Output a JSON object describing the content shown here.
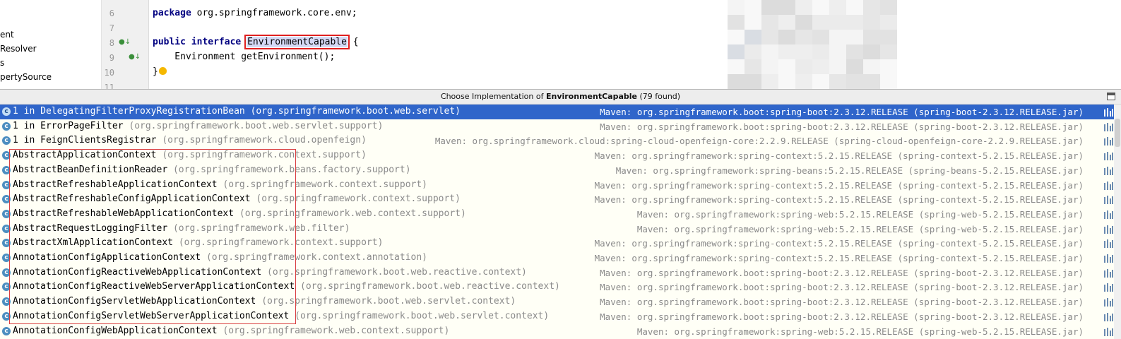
{
  "tree": {
    "items": [
      "ent",
      "Resolver",
      "s",
      "pertySource"
    ]
  },
  "editor": {
    "line_numbers": [
      "6",
      "7",
      "8",
      "9",
      "10",
      "11"
    ],
    "package_keyword": "package",
    "package_name": " org.springframework.core.env;",
    "public_keyword": "public",
    "interface_keyword": "interface",
    "interface_name": "EnvironmentCapable",
    "open_brace": " {",
    "method_line": "    Environment getEnvironment();",
    "close_brace": "}"
  },
  "popup": {
    "title_prefix": "Choose Implementation of ",
    "title_class": "EnvironmentCapable",
    "title_suffix": " (79 found)",
    "rows": [
      {
        "name": "1 in DelegatingFilterProxyRegistrationBean",
        "pkg": "(org.springframework.boot.web.servlet)",
        "maven": "Maven: org.springframework.boot:spring-boot:2.3.12.RELEASE (spring-boot-2.3.12.RELEASE.jar)",
        "selected": true
      },
      {
        "name": "1 in ErrorPageFilter",
        "pkg": "(org.springframework.boot.web.servlet.support)",
        "maven": "Maven: org.springframework.boot:spring-boot:2.3.12.RELEASE (spring-boot-2.3.12.RELEASE.jar)",
        "selected": false
      },
      {
        "name": "1 in FeignClientsRegistrar",
        "pkg": "(org.springframework.cloud.openfeign)",
        "maven": "Maven: org.springframework.cloud:spring-cloud-openfeign-core:2.2.9.RELEASE (spring-cloud-openfeign-core-2.2.9.RELEASE.jar)",
        "selected": false
      },
      {
        "name": "AbstractApplicationContext",
        "pkg": "(org.springframework.context.support)",
        "maven": "Maven: org.springframework:spring-context:5.2.15.RELEASE (spring-context-5.2.15.RELEASE.jar)",
        "selected": false
      },
      {
        "name": "AbstractBeanDefinitionReader",
        "pkg": "(org.springframework.beans.factory.support)",
        "maven": "Maven: org.springframework:spring-beans:5.2.15.RELEASE (spring-beans-5.2.15.RELEASE.jar)",
        "selected": false
      },
      {
        "name": "AbstractRefreshableApplicationContext",
        "pkg": "(org.springframework.context.support)",
        "maven": "Maven: org.springframework:spring-context:5.2.15.RELEASE (spring-context-5.2.15.RELEASE.jar)",
        "selected": false
      },
      {
        "name": "AbstractRefreshableConfigApplicationContext",
        "pkg": "(org.springframework.context.support)",
        "maven": "Maven: org.springframework:spring-context:5.2.15.RELEASE (spring-context-5.2.15.RELEASE.jar)",
        "selected": false
      },
      {
        "name": "AbstractRefreshableWebApplicationContext",
        "pkg": "(org.springframework.web.context.support)",
        "maven": "Maven: org.springframework:spring-web:5.2.15.RELEASE (spring-web-5.2.15.RELEASE.jar)",
        "selected": false
      },
      {
        "name": "AbstractRequestLoggingFilter",
        "pkg": "(org.springframework.web.filter)",
        "maven": "Maven: org.springframework:spring-web:5.2.15.RELEASE (spring-web-5.2.15.RELEASE.jar)",
        "selected": false
      },
      {
        "name": "AbstractXmlApplicationContext",
        "pkg": "(org.springframework.context.support)",
        "maven": "Maven: org.springframework:spring-context:5.2.15.RELEASE (spring-context-5.2.15.RELEASE.jar)",
        "selected": false
      },
      {
        "name": "AnnotationConfigApplicationContext",
        "pkg": "(org.springframework.context.annotation)",
        "maven": "Maven: org.springframework:spring-context:5.2.15.RELEASE (spring-context-5.2.15.RELEASE.jar)",
        "selected": false
      },
      {
        "name": "AnnotationConfigReactiveWebApplicationContext",
        "pkg": "(org.springframework.boot.web.reactive.context)",
        "maven": "Maven: org.springframework.boot:spring-boot:2.3.12.RELEASE (spring-boot-2.3.12.RELEASE.jar)",
        "selected": false
      },
      {
        "name": "AnnotationConfigReactiveWebServerApplicationContext",
        "pkg": "(org.springframework.boot.web.reactive.context)",
        "maven": "Maven: org.springframework.boot:spring-boot:2.3.12.RELEASE (spring-boot-2.3.12.RELEASE.jar)",
        "selected": false
      },
      {
        "name": "AnnotationConfigServletWebApplicationContext",
        "pkg": "(org.springframework.boot.web.servlet.context)",
        "maven": "Maven: org.springframework.boot:spring-boot:2.3.12.RELEASE (spring-boot-2.3.12.RELEASE.jar)",
        "selected": false
      },
      {
        "name": "AnnotationConfigServletWebServerApplicationContext",
        "pkg": "(org.springframework.boot.web.servlet.context)",
        "maven": "Maven: org.springframework.boot:spring-boot:2.3.12.RELEASE (spring-boot-2.3.12.RELEASE.jar)",
        "selected": false
      },
      {
        "name": "AnnotationConfigWebApplicationContext",
        "pkg": "(org.springframework.web.context.support)",
        "maven": "Maven: org.springframework:spring-web:5.2.15.RELEASE (spring-web-5.2.15.RELEASE.jar)",
        "selected": false
      }
    ]
  },
  "colors": {
    "selection": "#2f65ca",
    "annotation_red": "#e02020",
    "keyword": "#000080",
    "popup_bg": "#fffff6"
  }
}
